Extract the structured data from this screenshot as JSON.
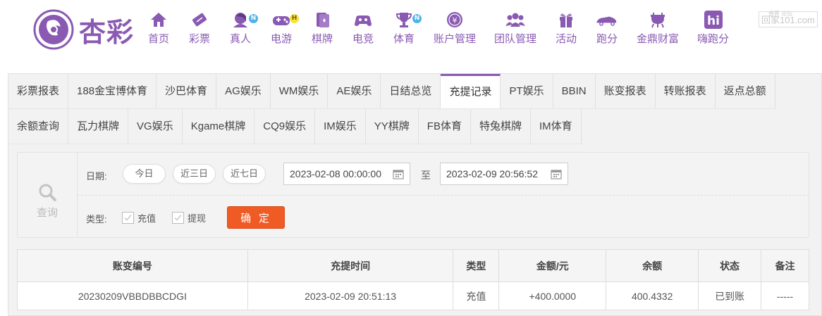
{
  "brand": {
    "name": "杏彩",
    "primary_color": "#8a5ab3"
  },
  "nav": [
    {
      "label": "首页",
      "icon": "home-icon"
    },
    {
      "label": "彩票",
      "icon": "ticket-icon"
    },
    {
      "label": "真人",
      "icon": "live-dealer-icon",
      "badge": "N"
    },
    {
      "label": "电游",
      "icon": "gamepad-icon",
      "badge": "H"
    },
    {
      "label": "棋牌",
      "icon": "cards-icon"
    },
    {
      "label": "电竞",
      "icon": "esports-controller-icon"
    },
    {
      "label": "体育",
      "icon": "trophy-icon",
      "badge": "N"
    },
    {
      "label": "账户管理",
      "icon": "account-coin-icon"
    },
    {
      "label": "团队管理",
      "icon": "team-icon"
    },
    {
      "label": "活动",
      "icon": "gift-icon"
    },
    {
      "label": "跑分",
      "icon": "car-icon"
    },
    {
      "label": "金鼎财富",
      "icon": "cauldron-icon"
    },
    {
      "label": "嗨跑分",
      "icon": "hi-app-icon"
    }
  ],
  "watermark": {
    "top": "香蕉 论坛",
    "main": "回家101.com"
  },
  "tabs": {
    "row1": [
      "彩票报表",
      "188金宝博体育",
      "沙巴体育",
      "AG娱乐",
      "WM娱乐",
      "AE娱乐",
      "日结总览",
      "充提记录",
      "PT娱乐",
      "BBIN",
      "账变报表",
      "转账报表",
      "返点总额"
    ],
    "row2": [
      "余额查询",
      "瓦力棋牌",
      "VG娱乐",
      "Kgame棋牌",
      "CQ9娱乐",
      "IM娱乐",
      "YY棋牌",
      "FB体育",
      "特兔棋牌",
      "IM体育"
    ],
    "active": "充提记录"
  },
  "filter": {
    "side_label": "查询",
    "date_label": "日期:",
    "quick_ranges": [
      "今日",
      "近三日",
      "近七日"
    ],
    "date_from": "2023-02-08 00:00:00",
    "date_sep": "至",
    "date_to": "2023-02-09 20:56:52",
    "type_label": "类型:",
    "type_options": [
      "充值",
      "提现"
    ],
    "confirm_label": "确 定"
  },
  "table": {
    "columns": [
      "账变编号",
      "充提时间",
      "类型",
      "金额/元",
      "余额",
      "状态",
      "备注"
    ],
    "rows": [
      {
        "id": "20230209VBBDBBCDGI",
        "time": "2023-02-09 20:51:13",
        "type": "充值",
        "amount": "+400.0000",
        "balance": "400.4332",
        "status": "已到账",
        "note": "-----"
      }
    ]
  },
  "colors": {
    "accent": "#8a5ab3",
    "confirm": "#f05a24",
    "amount": "#e02020",
    "status_ok": "#3aa53a"
  }
}
